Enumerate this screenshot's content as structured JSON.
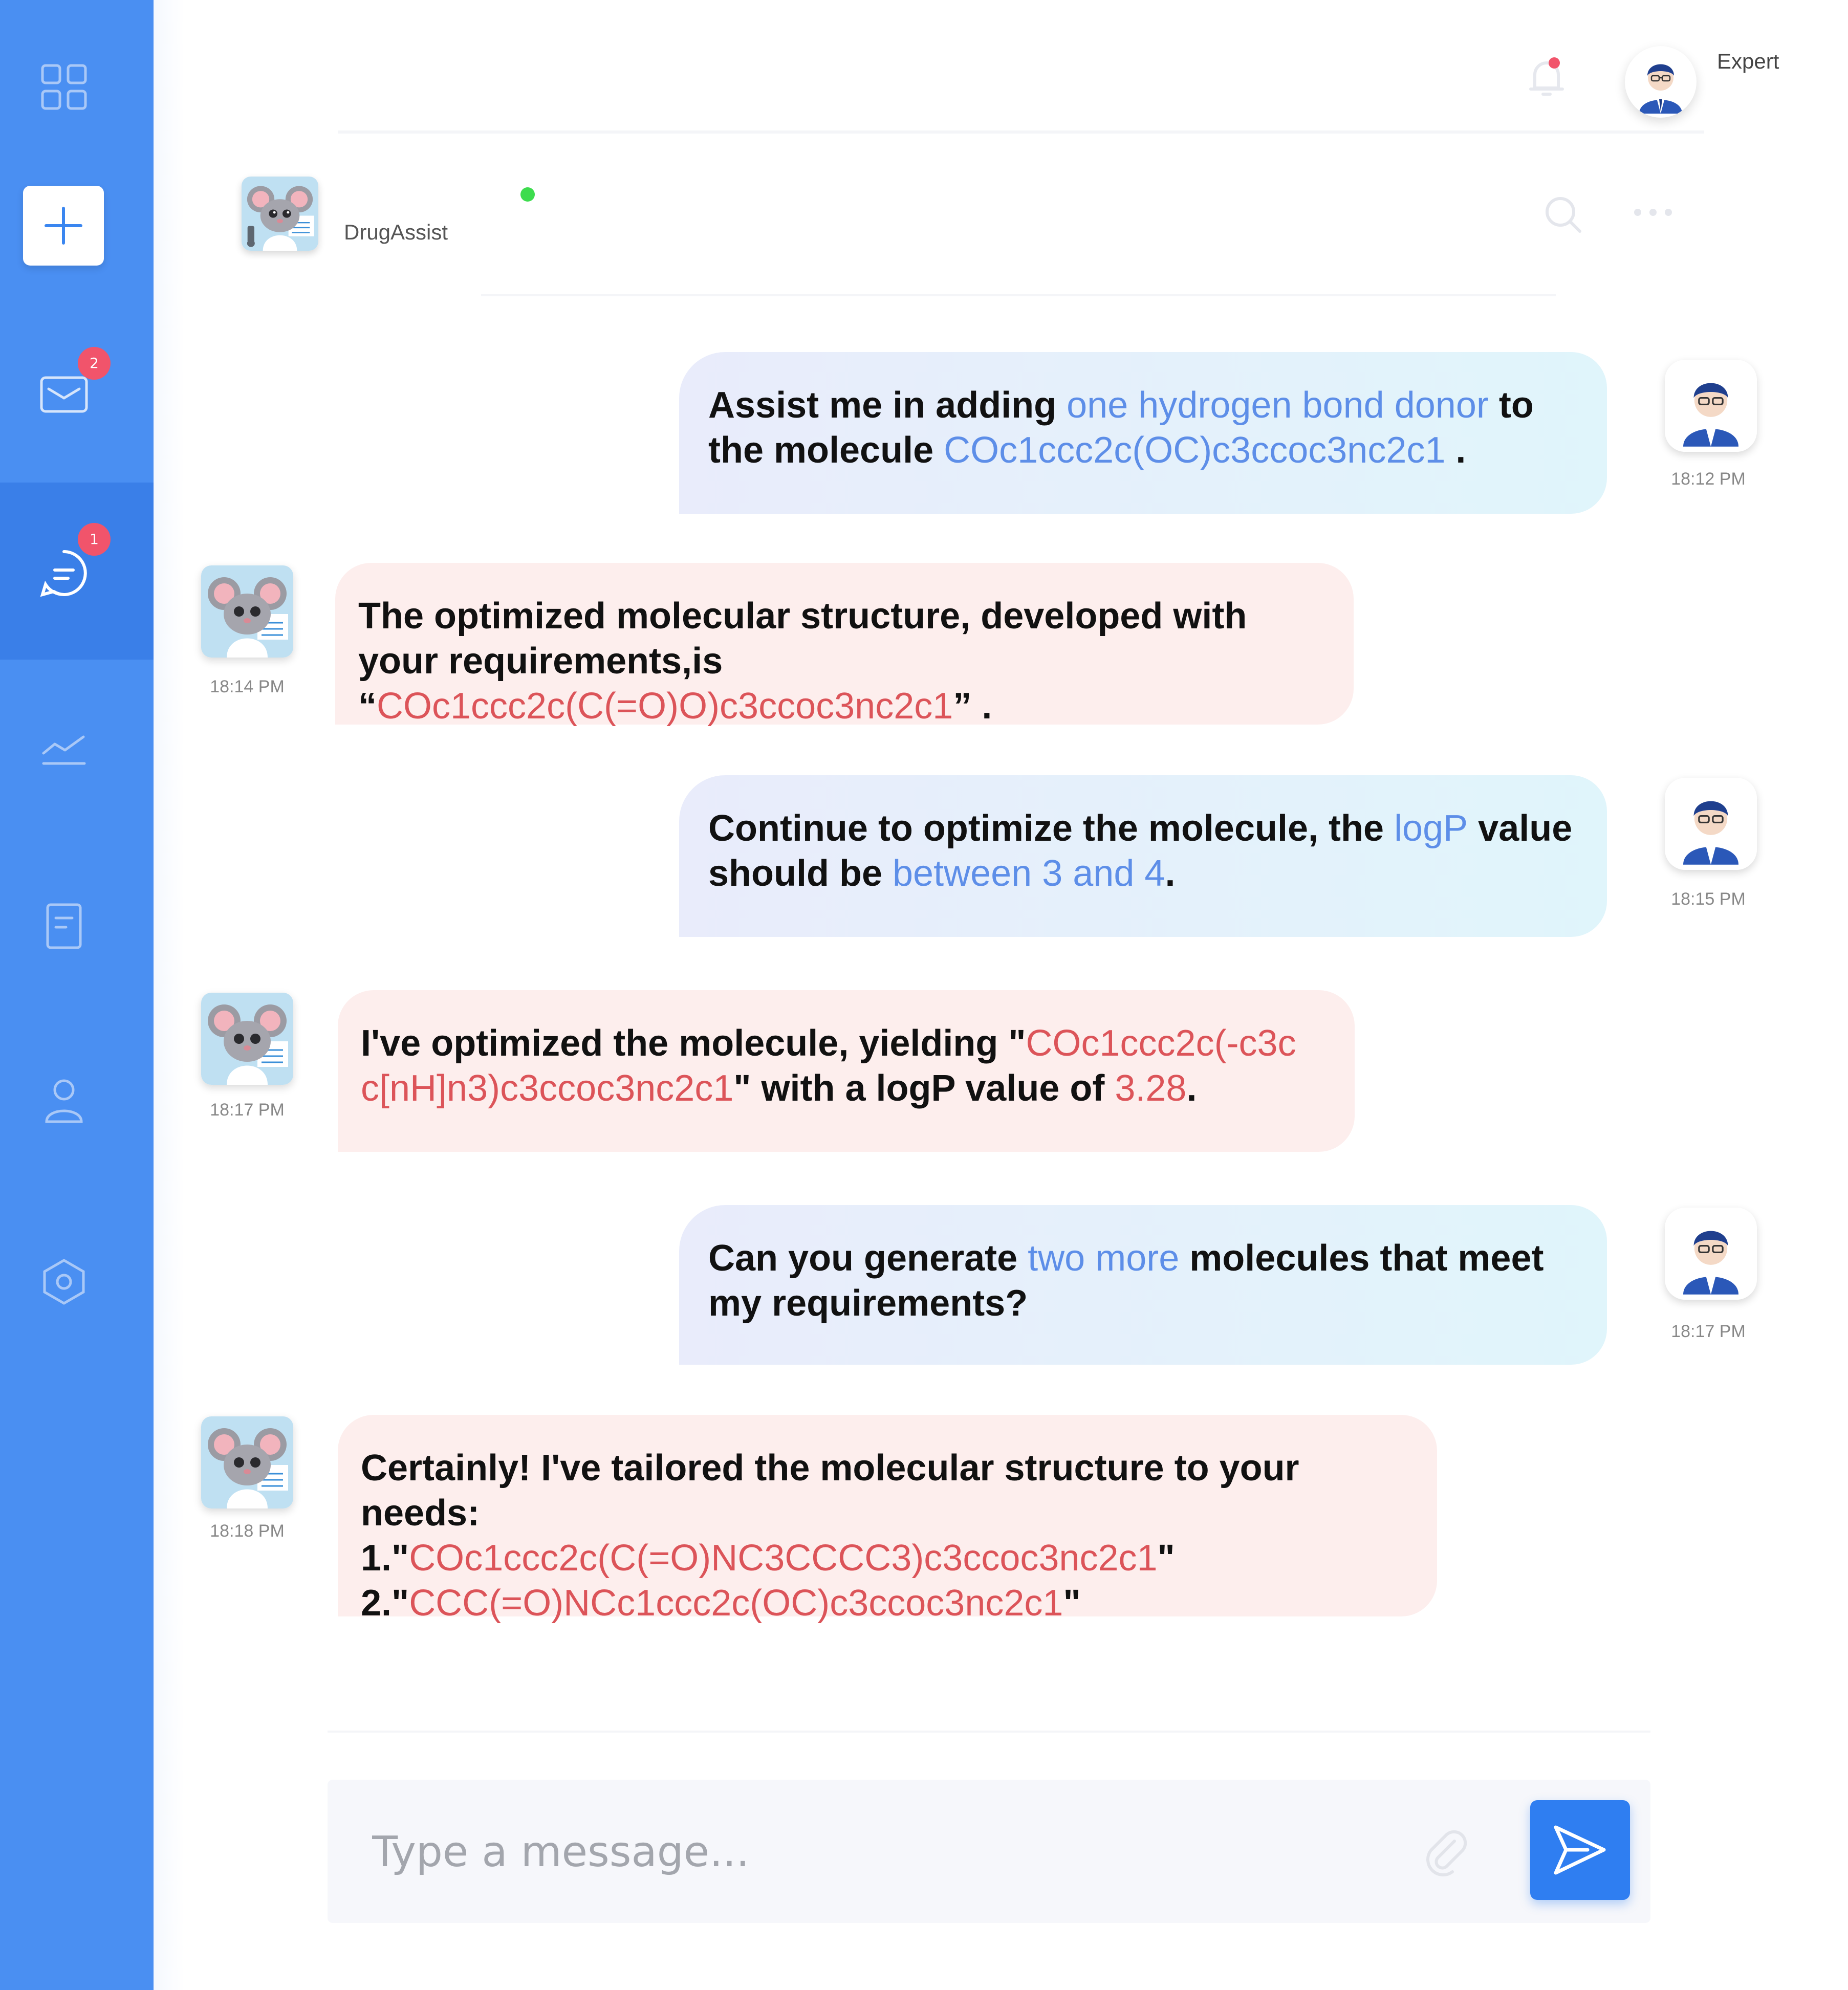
{
  "header": {
    "user_role": "Expert"
  },
  "sidebar": {
    "mail_badge": "2",
    "chat_badge": "1"
  },
  "chat": {
    "bot_name": "DrugAssist"
  },
  "messages": [
    {
      "sender": "user",
      "time": "18:12 PM",
      "parts": [
        {
          "text": "Assist me in adding "
        },
        {
          "text": "one hydrogen bond donor",
          "hl": "blue"
        },
        {
          "text": " to the molecule "
        },
        {
          "text": "COc1ccc2c(OC)c3ccoc3nc2c1",
          "hl": "blue"
        },
        {
          "text": " ."
        }
      ]
    },
    {
      "sender": "bot",
      "time": "18:14 PM",
      "parts": [
        {
          "text": "The optimized molecular structure, developed with your requirements,is “"
        },
        {
          "text": "COc1ccc2c(C(=O)O)c3ccoc3nc2c1",
          "hl": "red"
        },
        {
          "text": "” ."
        }
      ]
    },
    {
      "sender": "user",
      "time": "18:15 PM",
      "parts": [
        {
          "text": "Continue to optimize the molecule, the "
        },
        {
          "text": "logP",
          "hl": "blue"
        },
        {
          "text": " value should be "
        },
        {
          "text": "between 3 and 4",
          "hl": "blue"
        },
        {
          "text": "."
        }
      ]
    },
    {
      "sender": "bot",
      "time": "18:17 PM",
      "parts": [
        {
          "text": "I've optimized the molecule, yielding \""
        },
        {
          "text": "COc1ccc2c(-c3c c[nH]n3)c3ccoc3nc2c1",
          "hl": "red"
        },
        {
          "text": "\" with a logP value of "
        },
        {
          "text": "3.28",
          "hl": "red"
        },
        {
          "text": "."
        }
      ]
    },
    {
      "sender": "user",
      "time": "18:17 PM",
      "parts": [
        {
          "text": "Can you generate "
        },
        {
          "text": "two more",
          "hl": "blue"
        },
        {
          "text": " molecules that meet my requirements?"
        }
      ]
    },
    {
      "sender": "bot",
      "time": "18:18 PM",
      "parts": [
        {
          "text": "Certainly! I've tailored the molecular structure to your needs:"
        },
        {
          "text": "1.\"",
          "br": true
        },
        {
          "text": "COc1ccc2c(C(=O)NC3CCCC3)c3ccoc3nc2c1",
          "hl": "red"
        },
        {
          "text": "\""
        },
        {
          "text": "2.\"",
          "br": true
        },
        {
          "text": "CCC(=O)NCc1ccc2c(OC)c3ccoc3nc2c1",
          "hl": "red"
        },
        {
          "text": "\""
        }
      ]
    }
  ],
  "composer": {
    "placeholder": "Type a message..."
  },
  "colors": {
    "sidebar": "#4a8ff2",
    "user_highlight": "#5d8ee8",
    "bot_highlight": "#dc5459",
    "bot_bubble": "#fdeeed",
    "send_button": "#2f7ef1"
  }
}
